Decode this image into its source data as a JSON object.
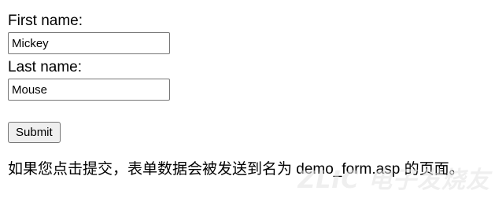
{
  "form": {
    "first_name_label": "First name:",
    "first_name_value": "Mickey",
    "last_name_label": "Last name:",
    "last_name_value": "Mouse",
    "submit_label": "Submit"
  },
  "note": "如果您点击提交，表单数据会被发送到名为 demo_form.asp 的页面。",
  "watermark": "ZLIC 电子发烧友"
}
